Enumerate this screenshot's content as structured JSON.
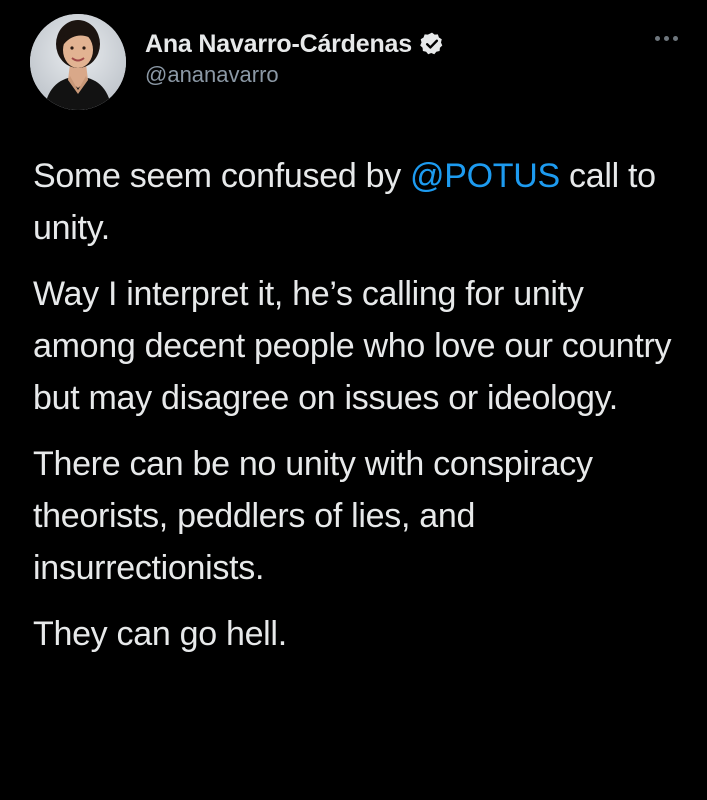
{
  "author": {
    "display_name": "Ana Navarro-Cárdenas",
    "handle": "@ananavarro",
    "verified": true,
    "avatar_icon": "profile-photo"
  },
  "menu_icon": "more-horizontal-icon",
  "colors": {
    "background": "#000000",
    "text": "#e7e9ea",
    "secondary_text": "#8b98a5",
    "link": "#1d9bf0"
  },
  "tweet": {
    "paragraph1": {
      "before": "Some seem confused by ",
      "mention": "@POTUS",
      "after": " call to unity."
    },
    "paragraph2": "Way I interpret it, he’s calling for unity among decent people who love our country but may disagree on issues or ideology.",
    "paragraph3": "There can be no unity with conspiracy theorists, peddlers of lies, and insurrectionists.",
    "paragraph4": "They can go hell."
  }
}
